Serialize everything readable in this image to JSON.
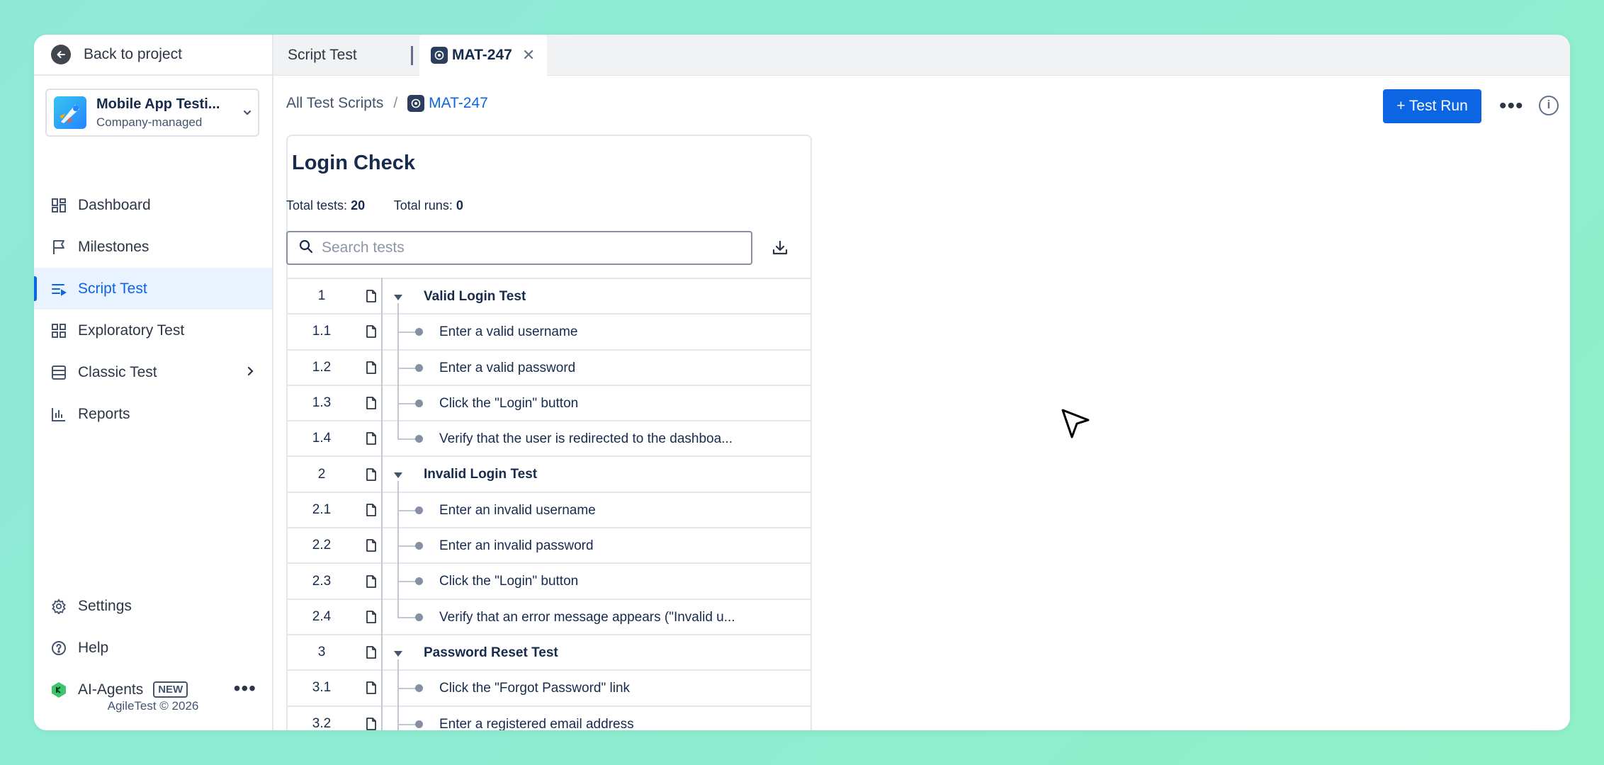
{
  "sidebar": {
    "back_label": "Back to project",
    "project": {
      "name": "Mobile App Testi...",
      "subtitle": "Company-managed"
    },
    "nav": [
      {
        "label": "Dashboard",
        "icon": "dashboard-icon"
      },
      {
        "label": "Milestones",
        "icon": "flag-icon"
      },
      {
        "label": "Script Test",
        "icon": "script-list-icon",
        "active": true
      },
      {
        "label": "Exploratory Test",
        "icon": "grid-icon"
      },
      {
        "label": "Classic Test",
        "icon": "table-icon",
        "has_children": true
      },
      {
        "label": "Reports",
        "icon": "bar-chart-icon"
      }
    ],
    "bottom": {
      "settings": "Settings",
      "help": "Help",
      "ai_agents": "AI-Agents",
      "new_badge": "NEW"
    },
    "footer": "AgileTest © 2026"
  },
  "tabs": [
    {
      "label": "Script Test"
    },
    {
      "label": "MAT-247",
      "active": true
    }
  ],
  "breadcrumb": {
    "root": "All Test Scripts",
    "separator": "/",
    "current": "MAT-247"
  },
  "actions": {
    "test_run_label": "+ Test Run"
  },
  "panel": {
    "title": "Login Check",
    "total_tests_label": "Total tests:",
    "total_tests": "20",
    "total_runs_label": "Total runs:",
    "total_runs": "0",
    "search_placeholder": "Search tests"
  },
  "rows": [
    {
      "num": "1",
      "text": "Valid Login Test",
      "type": "group"
    },
    {
      "num": "1.1",
      "text": "Enter a valid username",
      "type": "step"
    },
    {
      "num": "1.2",
      "text": "Enter a valid password",
      "type": "step"
    },
    {
      "num": "1.3",
      "text": "Click the \"Login\" button",
      "type": "step"
    },
    {
      "num": "1.4",
      "text": "Verify that the user is redirected to the dashboa...",
      "type": "step",
      "last": true
    },
    {
      "num": "2",
      "text": "Invalid Login Test",
      "type": "group"
    },
    {
      "num": "2.1",
      "text": "Enter an invalid username",
      "type": "step"
    },
    {
      "num": "2.2",
      "text": "Enter an invalid password",
      "type": "step"
    },
    {
      "num": "2.3",
      "text": "Click the \"Login\" button",
      "type": "step"
    },
    {
      "num": "2.4",
      "text": "Verify that an error message appears (\"Invalid u...",
      "type": "step",
      "last": true
    },
    {
      "num": "3",
      "text": "Password Reset Test",
      "type": "group"
    },
    {
      "num": "3.1",
      "text": "Click the \"Forgot Password\" link",
      "type": "step"
    },
    {
      "num": "3.2",
      "text": "Enter a registered email address",
      "type": "step"
    }
  ],
  "colors": {
    "accent": "#0c66e4",
    "active_bg": "#e9f2ff",
    "background": "#8fecd0"
  }
}
